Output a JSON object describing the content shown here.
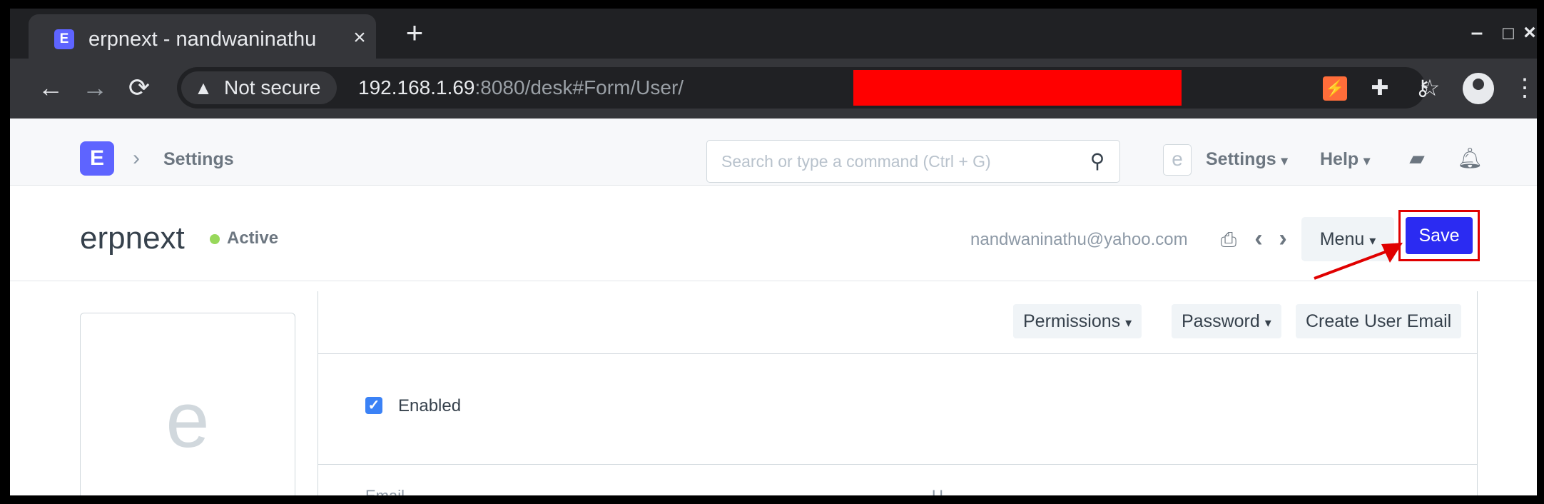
{
  "tab": {
    "title": "erpnext - nandwaninathu",
    "favicon_letter": "E",
    "close_glyph": "×",
    "new_tab_glyph": "+"
  },
  "window_controls": {
    "minimize": "–",
    "maximize": "□",
    "close": "×"
  },
  "addressbar": {
    "back": "←",
    "forward": "→",
    "reload": "⟳",
    "security_icon": "warning-icon",
    "security_label": "Not secure",
    "url_host": "192.168.1.69",
    "url_rest": ":8080/desk#Form/User/",
    "bookmark_icon": "☆"
  },
  "navbar": {
    "logo_letter": "E",
    "breadcrumb": "Settings",
    "search_placeholder": "Search or type a command (Ctrl + G)",
    "avatar_letter": "e",
    "settings_label": "Settings",
    "help_label": "Help"
  },
  "page_head": {
    "title": "erpnext",
    "status": "Active",
    "email": "nandwaninathu@yahoo.com",
    "menu_label": "Menu",
    "save_label": "Save"
  },
  "sidebar": {
    "avatar_letter": "e"
  },
  "form": {
    "toolbar_buttons": [
      "Permissions",
      "Password",
      "Create User Email"
    ],
    "enabled_label": "Enabled",
    "enabled_checked": true,
    "partial_labels": [
      "Email",
      "U"
    ]
  },
  "colors": {
    "accent": "#5e64ff",
    "save_button": "#2b2bf2",
    "highlight_border": "#e00000",
    "status_dot": "#98d85b",
    "redaction": "#ff0000"
  }
}
